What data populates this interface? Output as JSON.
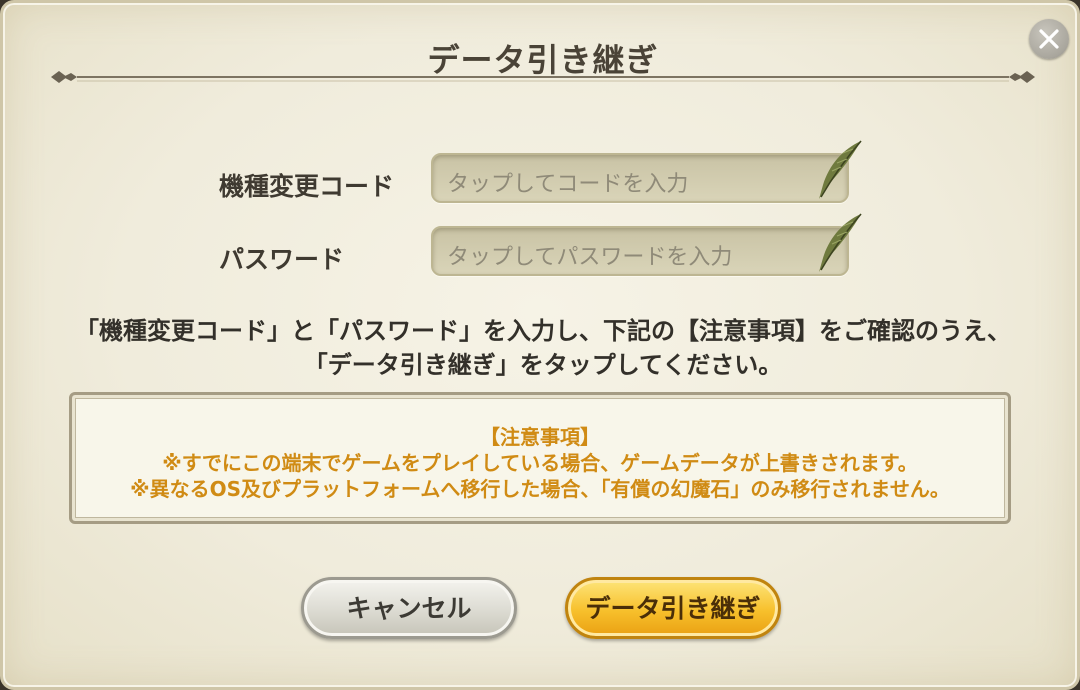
{
  "dialog": {
    "title": "データ引き継ぎ",
    "close_icon": "close-icon"
  },
  "form": {
    "code_label": "機種変更コード",
    "code_placeholder": "タップしてコードを入力",
    "password_label": "パスワード",
    "password_placeholder": "タップしてパスワードを入力",
    "field_icon": "quill-pen-icon"
  },
  "instruction": {
    "line1": "「機種変更コード」と「パスワード」を入力し、下記の【注意事項】をご確認のうえ、",
    "line2": "「データ引き継ぎ」をタップしてください。"
  },
  "notice": {
    "heading": "【注意事項】",
    "line1": "※すでにこの端末でゲームをプレイしている場合、ゲームデータが上書きされます。",
    "line2": "※異なるOS及びプラットフォームへ移行した場合、「有償の幻魔石」のみ移行されません。"
  },
  "buttons": {
    "cancel_label": "キャンセル",
    "confirm_label": "データ引き継ぎ"
  },
  "colors": {
    "background": "#f0ecdc",
    "notice_text": "#d08b14",
    "confirm_button": "#f7c02c",
    "cancel_button": "#dcdbd2"
  }
}
